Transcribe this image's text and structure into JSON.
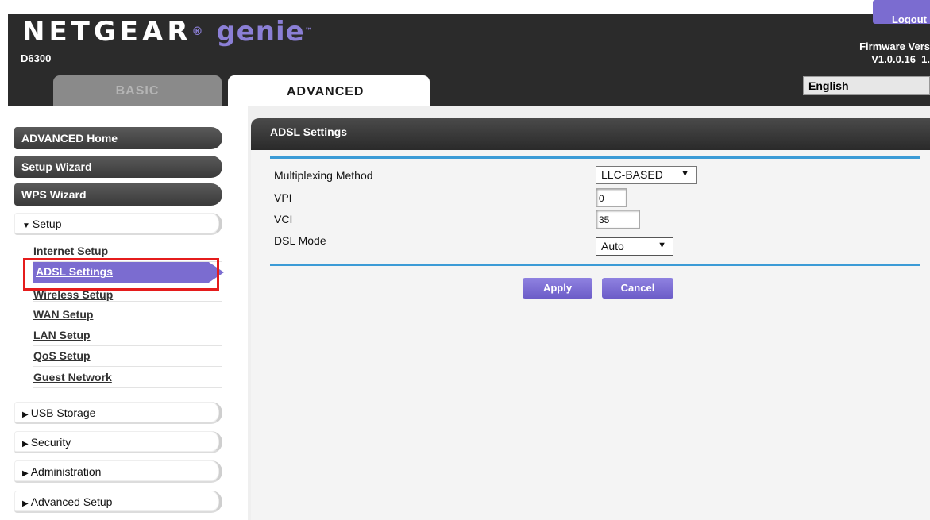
{
  "header": {
    "brand": "NETGEAR",
    "product": "genie",
    "trademark": "™",
    "model": "D6300",
    "logout_label": "Logout",
    "firmware_label": "Firmware Vers",
    "firmware_value": "V1.0.0.16_1.",
    "language": "English"
  },
  "tabs": {
    "basic": "BASIC",
    "advanced": "ADVANCED"
  },
  "sidebar": {
    "advanced_home": "ADVANCED Home",
    "setup_wizard": "Setup Wizard",
    "wps_wizard": "WPS Wizard",
    "setup": "Setup",
    "setup_items": [
      "Internet Setup",
      "ADSL Settings",
      "Wireless Setup",
      "WAN Setup",
      "LAN Setup",
      "QoS Setup",
      "Guest Network"
    ],
    "usb_storage": "USB Storage",
    "security": "Security",
    "administration": "Administration",
    "advanced_setup": "Advanced Setup"
  },
  "panel": {
    "title": "ADSL Settings",
    "fields": {
      "multiplexing_label": "Multiplexing Method",
      "multiplexing_value": "LLC-BASED",
      "vpi_label": "VPI",
      "vpi_value": "0",
      "vci_label": "VCI",
      "vci_value": "35",
      "dsl_mode_label": "DSL Mode",
      "dsl_mode_value": "Auto"
    },
    "apply": "Apply",
    "cancel": "Cancel"
  },
  "colors": {
    "accent": "#7b6cd0",
    "header_bg": "#2b2b2b",
    "rule": "#3b9bd6",
    "highlight": "#e51c1c"
  }
}
